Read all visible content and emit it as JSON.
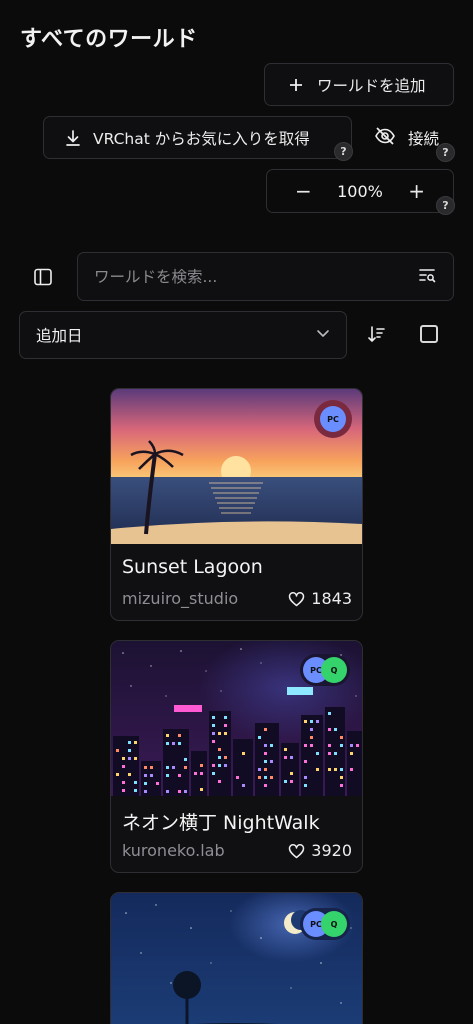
{
  "page": {
    "title": "すべてのワールド"
  },
  "toolbar": {
    "add_world_label": "ワールドを追加",
    "fetch_favorites_label": "VRChat からお気に入りを取得",
    "connect_label": "接続",
    "help_mark": "?",
    "zoom_value": "100%",
    "zoom_minus": "−",
    "zoom_plus": "+"
  },
  "search": {
    "placeholder": "ワールドを検索..."
  },
  "sort": {
    "selected": "追加日"
  },
  "worlds": [
    {
      "name": "Sunset Lagoon",
      "author": "mizuiro_studio",
      "likes": "1843",
      "platforms": [
        "PC"
      ]
    },
    {
      "name": "ネオン横丁 NightWalk",
      "author": "kuroneko.lab",
      "likes": "3920",
      "platforms": [
        "PC",
        "Q"
      ]
    },
    {
      "name": "",
      "author": "",
      "likes": "",
      "platforms": [
        "PC",
        "Q"
      ]
    }
  ],
  "colors": {
    "background": "#0b0b0c",
    "border": "#2e2e33",
    "pc_badge": "#6a8dff",
    "quest_badge": "#35d36b"
  },
  "icons": [
    "plus-icon",
    "download-icon",
    "eye-off-icon",
    "help-icon",
    "sidebar-icon",
    "search-filter-icon",
    "chevron-down-icon",
    "sort-icon",
    "checkbox-icon",
    "heart-icon"
  ]
}
